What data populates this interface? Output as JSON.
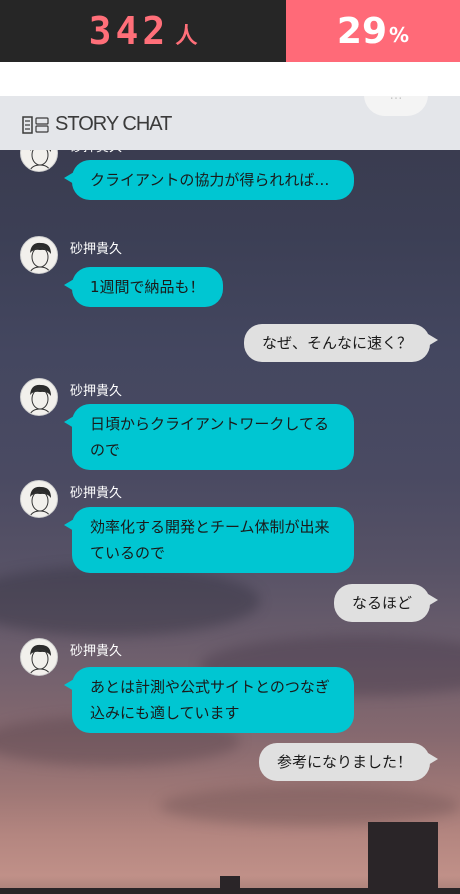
{
  "stats": {
    "count": "342",
    "count_unit": "人",
    "percent": "29",
    "percent_unit": "%",
    "count_color": "#ff6f79",
    "percent_bg": "#ff6a78"
  },
  "header": {
    "logo_text": "STORY CHAT",
    "logo_icon": "document-icon"
  },
  "top_pill": {
    "label": "…"
  },
  "messages": [
    {
      "type": "incoming",
      "sender": "砂押貴久",
      "text": "クライアントの協力が得られれば…"
    },
    {
      "type": "incoming",
      "sender": "砂押貴久",
      "text": "1週間で納品も！"
    },
    {
      "type": "outgoing",
      "text": "なぜ、そんなに速く？"
    },
    {
      "type": "incoming",
      "sender": "砂押貴久",
      "text": "日頃からクライアントワークしてるので"
    },
    {
      "type": "incoming",
      "sender": "砂押貴久",
      "text": "効率化する開発とチーム体制が出来ているので"
    },
    {
      "type": "outgoing",
      "text": "なるほど"
    },
    {
      "type": "incoming",
      "sender": "砂押貴久",
      "text": "あとは計測や公式サイトとのつなぎ込みにも適しています"
    },
    {
      "type": "outgoing",
      "text": "参考になりました！"
    }
  ],
  "colors": {
    "incoming_bubble": "#00c6d2",
    "outgoing_bubble": "#e0e0e0"
  }
}
